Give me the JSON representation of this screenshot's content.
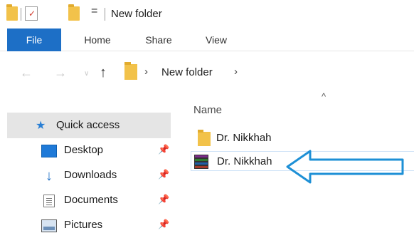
{
  "window": {
    "title": "New folder"
  },
  "quick_access_toolbar": {
    "dropdown_glyph": "="
  },
  "ribbon": {
    "tabs": [
      {
        "label": "File",
        "active": true
      },
      {
        "label": "Home"
      },
      {
        "label": "Share"
      },
      {
        "label": "View"
      }
    ]
  },
  "address_bar": {
    "path": [
      "New folder"
    ],
    "back_icon": "back-arrow-icon",
    "forward_icon": "forward-arrow-icon",
    "up_icon": "up-arrow-icon"
  },
  "navigation_pane": {
    "quick_access": {
      "label": "Quick access",
      "icon": "star-icon"
    },
    "items": [
      {
        "label": "Desktop",
        "icon": "desktop-icon",
        "pinned": true
      },
      {
        "label": "Downloads",
        "icon": "download-icon",
        "pinned": true
      },
      {
        "label": "Documents",
        "icon": "documents-icon",
        "pinned": true
      },
      {
        "label": "Pictures",
        "icon": "pictures-icon",
        "pinned": true
      }
    ]
  },
  "file_list": {
    "column_header": "Name",
    "sort": "ascending",
    "items": [
      {
        "name": "Dr. Nikkhah",
        "type": "folder",
        "icon": "folder-icon"
      },
      {
        "name": "Dr. Nikkhah",
        "type": "rar-archive",
        "icon": "winrar-archive-icon"
      }
    ]
  },
  "annotation": {
    "type": "arrow",
    "color": "#1e90d6",
    "points_to": "file_list.items.1"
  },
  "colors": {
    "accent": "#1d6fc6",
    "folder": "#f2c24a",
    "annotation": "#1e90d6"
  }
}
